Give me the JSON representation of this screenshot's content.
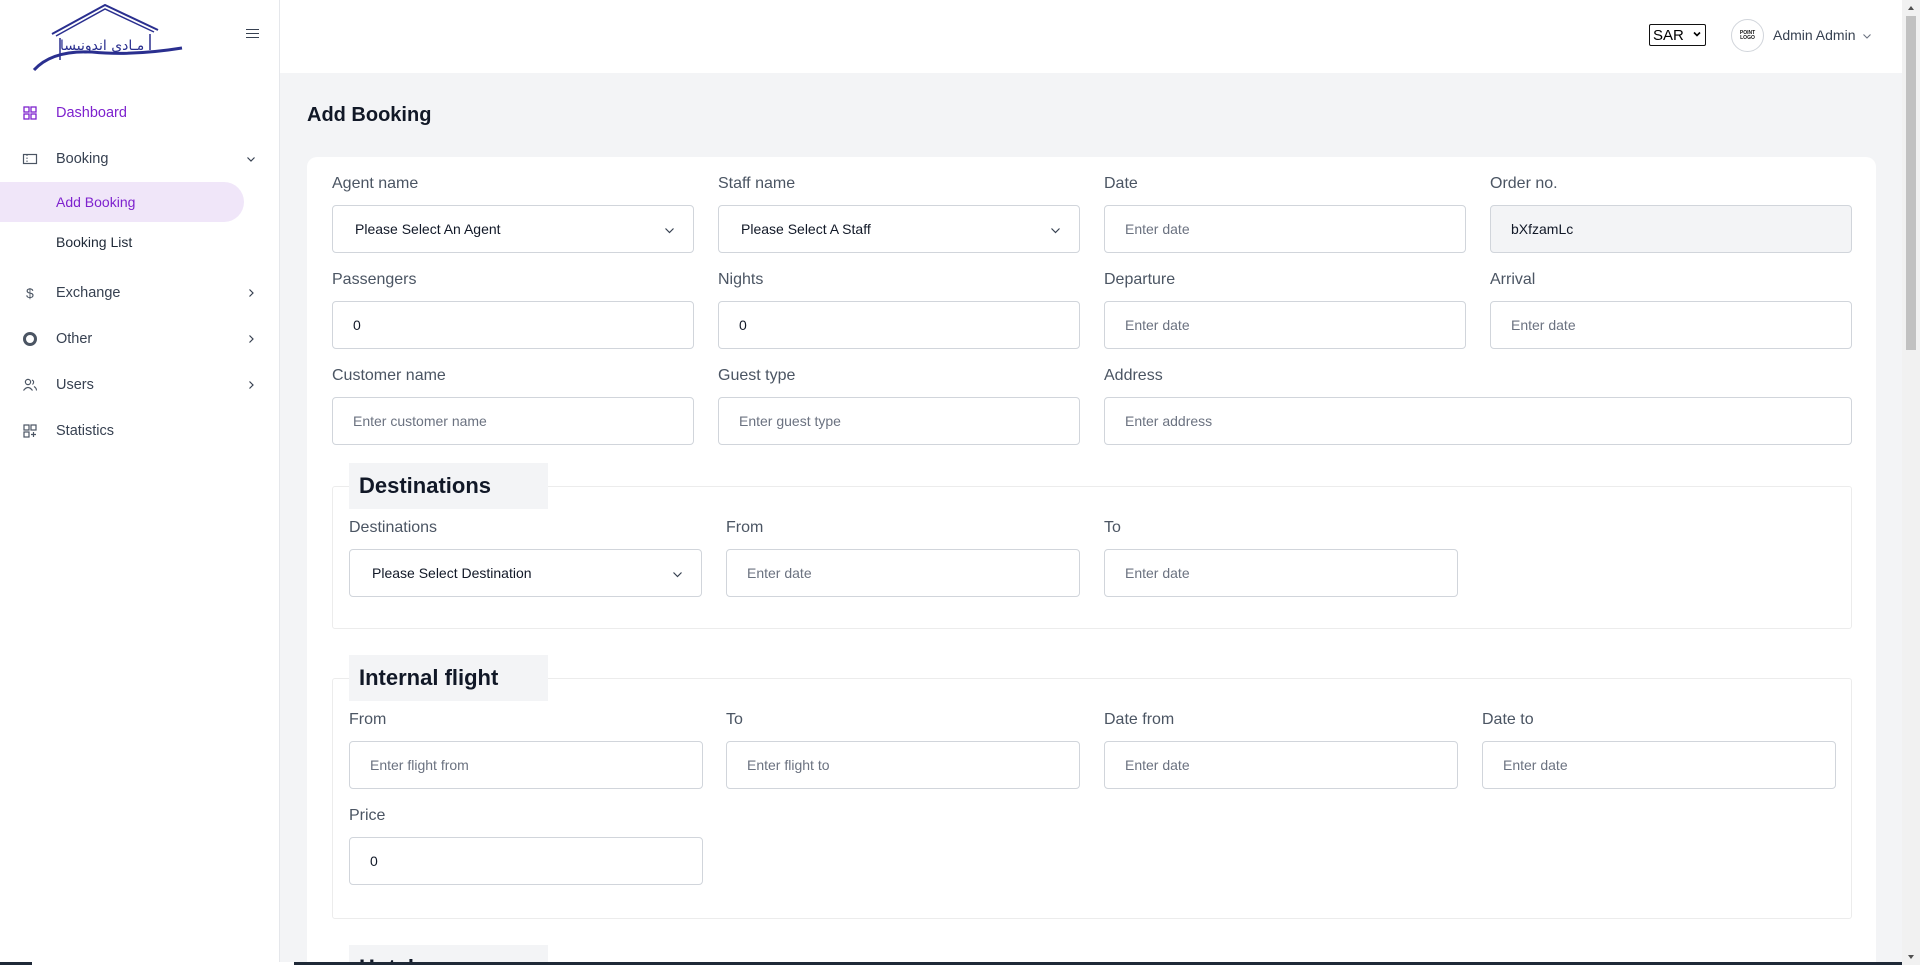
{
  "brand": {
    "logo_text": "مـادى اندونيسا"
  },
  "sidebar": {
    "items": [
      {
        "label": "Dashboard",
        "icon": "dashboard-icon"
      },
      {
        "label": "Booking",
        "icon": "ticket-icon"
      },
      {
        "label": "Exchange",
        "icon": "dollar-icon"
      },
      {
        "label": "Other",
        "icon": "circle-icon"
      },
      {
        "label": "Users",
        "icon": "users-icon"
      },
      {
        "label": "Statistics",
        "icon": "statistics-icon"
      }
    ],
    "booking_sub": [
      {
        "label": "Add Booking"
      },
      {
        "label": "Booking List"
      }
    ]
  },
  "header": {
    "currency": "SAR",
    "avatar_text": "POINT LOGO",
    "user_name": "Admin Admin"
  },
  "page": {
    "title": "Add Booking"
  },
  "form": {
    "agent": {
      "label": "Agent name",
      "value": "Please Select An Agent"
    },
    "staff": {
      "label": "Staff name",
      "value": "Please Select A Staff"
    },
    "date": {
      "label": "Date",
      "placeholder": "Enter date"
    },
    "order": {
      "label": "Order no.",
      "value": "bXfzamLc"
    },
    "passengers": {
      "label": "Passengers",
      "value": "0"
    },
    "nights": {
      "label": "Nights",
      "value": "0"
    },
    "departure": {
      "label": "Departure",
      "placeholder": "Enter date"
    },
    "arrival": {
      "label": "Arrival",
      "placeholder": "Enter date"
    },
    "customer": {
      "label": "Customer name",
      "placeholder": "Enter customer name"
    },
    "guest": {
      "label": "Guest type",
      "placeholder": "Enter guest type"
    },
    "address": {
      "label": "Address",
      "placeholder": "Enter address"
    }
  },
  "destinations": {
    "title": "Destinations",
    "dest": {
      "label": "Destinations",
      "value": "Please Select Destination"
    },
    "from": {
      "label": "From",
      "placeholder": "Enter date"
    },
    "to": {
      "label": "To",
      "placeholder": "Enter date"
    }
  },
  "flight": {
    "title": "Internal flight",
    "from": {
      "label": "From",
      "placeholder": "Enter flight from"
    },
    "to": {
      "label": "To",
      "placeholder": "Enter flight to"
    },
    "date_from": {
      "label": "Date from",
      "placeholder": "Enter date"
    },
    "date_to": {
      "label": "Date to",
      "placeholder": "Enter date"
    },
    "price": {
      "label": "Price",
      "value": "0"
    }
  },
  "hotel": {
    "title": "Hotel"
  },
  "colors": {
    "accent": "#7e22ce",
    "active_bg": "#f0e6f9",
    "logo": "#2a2f8f"
  }
}
